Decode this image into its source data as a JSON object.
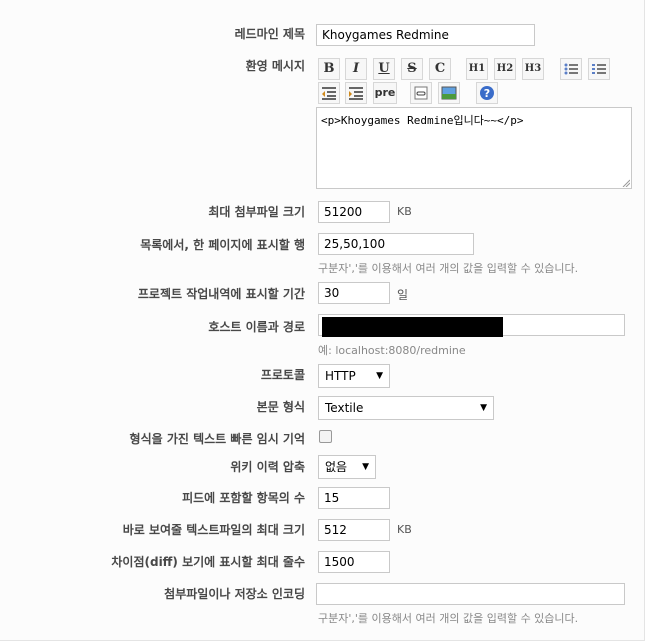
{
  "settings": {
    "app_title": {
      "label": "레드마인 제목",
      "value": "Khoygames Redmine"
    },
    "welcome_text": {
      "label": "환영 메시지",
      "toolbar": {
        "bold": "B",
        "italic": "I",
        "underline": "U",
        "strike": "S",
        "code": "C",
        "h1": "H1",
        "h2": "H2",
        "h3": "H3",
        "pre": "pre"
      },
      "value": "<p>Khoygames Redmine입니다~~</p>"
    },
    "attachment_max_size": {
      "label": "최대 첨부파일 크기",
      "value": "51200",
      "unit": "KB"
    },
    "per_page_options": {
      "label": "목록에서, 한 페이지에 표시할 행",
      "value": "25,50,100",
      "hint": "구분자','를 이용해서 여러 개의 값을 입력할 수 있습니다."
    },
    "activity_days": {
      "label": "프로젝트 작업내역에 표시할 기간",
      "value": "30",
      "unit": "일"
    },
    "host_name": {
      "label": "호스트 이름과 경로",
      "value": "",
      "hint": "예: localhost:8080/redmine"
    },
    "protocol": {
      "label": "프로토콜",
      "value": "HTTP"
    },
    "text_formatting": {
      "label": "본문 형식",
      "value": "Textile"
    },
    "cache_formatted_text": {
      "label": "형식을 가진 텍스트 빠른 임시 기억",
      "checked": false
    },
    "wiki_compression": {
      "label": "위키 이력 압축",
      "value": "없음"
    },
    "feeds_limit": {
      "label": "피드에 포함할 항목의 수",
      "value": "15"
    },
    "file_max_size_displayed": {
      "label": "바로 보여줄 텍스트파일의 최대 크기",
      "value": "512",
      "unit": "KB"
    },
    "diff_max_lines": {
      "label": "차이점(diff) 보기에 표시할 최대 줄수",
      "value": "1500"
    },
    "repositories_encodings": {
      "label": "첨부파일이나 저장소 인코딩",
      "value": "",
      "hint": "구분자','를 이용해서 여러 개의 값을 입력할 수 있습니다."
    }
  },
  "colors": {
    "label": "#484848",
    "hint": "#888888",
    "border": "#c9c9c9",
    "help_blue": "#3a6cc9"
  }
}
